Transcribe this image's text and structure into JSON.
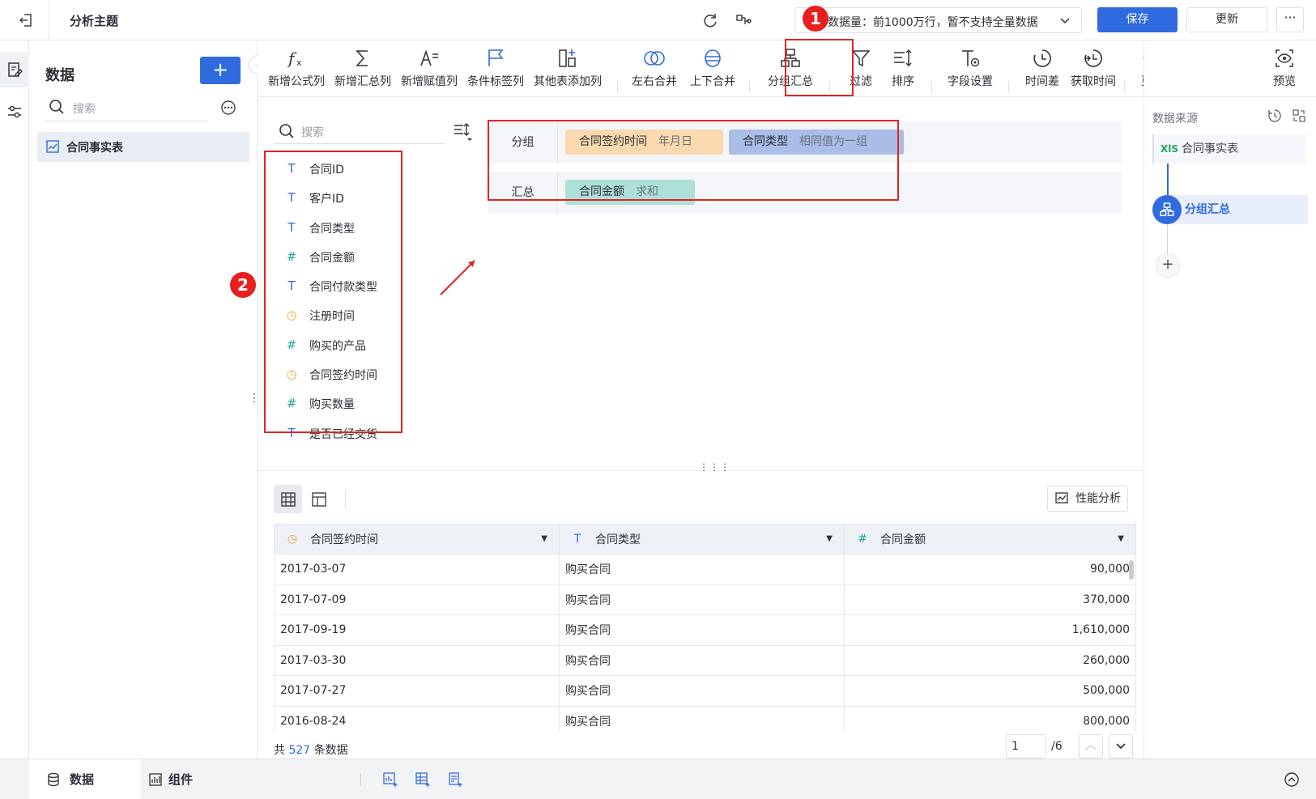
{
  "topbar": {
    "title": "分析主题",
    "data_volume": "数据量：前1000万行，暂不支持全量数据",
    "save_label": "保存",
    "update_label": "更新",
    "more_label": "···"
  },
  "data_panel": {
    "heading": "数据",
    "add_label": "+",
    "search_placeholder": "搜索",
    "table_name": "合同事实表"
  },
  "toolbar": {
    "items": [
      {
        "label": "新增公式列",
        "icon": "formula-icon"
      },
      {
        "label": "新增汇总列",
        "icon": "sigma-icon"
      },
      {
        "label": "新增赋值列",
        "icon": "assign-icon"
      },
      {
        "label": "条件标签列",
        "icon": "flag-icon"
      },
      {
        "label": "其他表添加列",
        "icon": "add-column-icon"
      },
      {
        "label": "左右合并",
        "icon": "merge-lr-icon"
      },
      {
        "label": "上下合并",
        "icon": "merge-ud-icon"
      },
      {
        "label": "分组汇总",
        "icon": "group-summary-icon"
      },
      {
        "label": "过滤",
        "icon": "filter-icon"
      },
      {
        "label": "排序",
        "icon": "sort-icon"
      },
      {
        "label": "字段设置",
        "icon": "field-settings-icon"
      },
      {
        "label": "时间差",
        "icon": "time-diff-icon"
      },
      {
        "label": "获取时间",
        "icon": "get-time-icon"
      },
      {
        "label": "更多",
        "icon": "more-icon"
      },
      {
        "label": "预览",
        "icon": "preview-icon"
      }
    ]
  },
  "annotations": {
    "badge1": "1",
    "badge2": "2"
  },
  "fields": {
    "search_placeholder": "搜索",
    "items": [
      {
        "name": "合同ID",
        "type": "text",
        "icon": "T"
      },
      {
        "name": "客户ID",
        "type": "text",
        "icon": "T"
      },
      {
        "name": "合同类型",
        "type": "text",
        "icon": "T"
      },
      {
        "name": "合同金额",
        "type": "number",
        "icon": "#"
      },
      {
        "name": "合同付款类型",
        "type": "text",
        "icon": "T"
      },
      {
        "name": "注册时间",
        "type": "date",
        "icon": "◷"
      },
      {
        "name": "购买的产品",
        "type": "number",
        "icon": "#"
      },
      {
        "name": "合同签约时间",
        "type": "date",
        "icon": "◷"
      },
      {
        "name": "购买数量",
        "type": "number",
        "icon": "#"
      },
      {
        "name": "是否已经交货",
        "type": "text",
        "icon": "T"
      }
    ]
  },
  "config": {
    "group_label": "分组",
    "summary_label": "汇总",
    "group_chips": [
      {
        "field": "合同签约时间",
        "mode": "年月日",
        "color": "#f9d9ad"
      },
      {
        "field": "合同类型",
        "mode": "相同值为一组",
        "color": "#a9bde6"
      }
    ],
    "summary_chips": [
      {
        "field": "合同金额",
        "mode": "求和",
        "color": "#ace0d9"
      }
    ]
  },
  "perf_label": "性能分析",
  "grid": {
    "columns": [
      {
        "name": "合同签约时间",
        "icon": "◷",
        "color": "#f0a540"
      },
      {
        "name": "合同类型",
        "icon": "T",
        "color": "#2f6bde"
      },
      {
        "name": "合同金额",
        "icon": "#",
        "color": "#26a69a"
      }
    ],
    "rows": [
      [
        "2017-03-07",
        "购买合同",
        "90,000"
      ],
      [
        "2017-07-09",
        "购买合同",
        "370,000"
      ],
      [
        "2017-09-19",
        "购买合同",
        "1,610,000"
      ],
      [
        "2017-03-30",
        "购买合同",
        "260,000"
      ],
      [
        "2017-07-27",
        "购买合同",
        "500,000"
      ],
      [
        "2016-08-24",
        "购买合同",
        "800,000"
      ]
    ]
  },
  "footer": {
    "prefix": "共",
    "count": "527",
    "suffix": "条数据",
    "page_value": "1",
    "page_total": "/6"
  },
  "right_panel": {
    "header": "数据来源",
    "source": "合同事实表",
    "source_badge": "XlS",
    "step": "分组汇总",
    "add_label": "+"
  },
  "bottombar": {
    "tab_data": "数据",
    "tab_component": "组件"
  },
  "colors": {
    "primary": "#2f6bde",
    "highlight_red": "#e02424"
  }
}
